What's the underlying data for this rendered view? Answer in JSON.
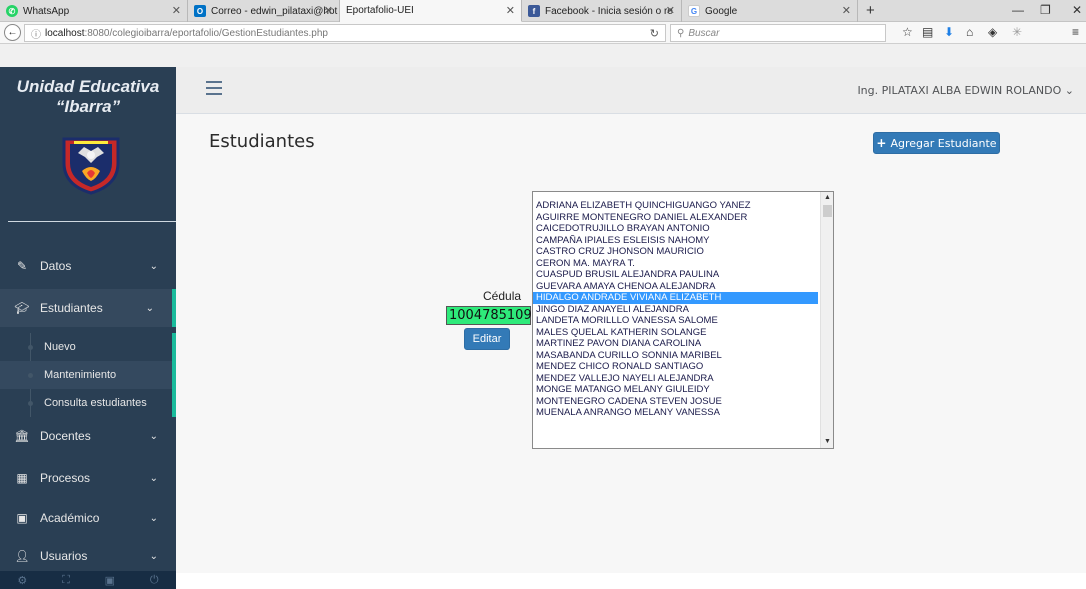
{
  "browser": {
    "tabs": [
      {
        "label": "WhatsApp",
        "icon": "whatsapp-icon"
      },
      {
        "label": "Correo - edwin_pilataxi@hot",
        "icon": "outlook-icon"
      },
      {
        "label": "Eportafolio-UEI",
        "icon": "none"
      },
      {
        "label": "Facebook - Inicia sesión o re",
        "icon": "facebook-icon"
      },
      {
        "label": "Google",
        "icon": "google-icon"
      }
    ],
    "url_host": "localhost",
    "url_path": ":8080/colegioibarra/eportafolio/GestionEstudiantes.php",
    "search_placeholder": "Buscar"
  },
  "sidebar": {
    "brand_line1": "Unidad Educativa",
    "brand_line2": "“Ibarra”",
    "menu": [
      {
        "label": "Datos",
        "icon": "edit-icon"
      },
      {
        "label": "Estudiantes",
        "icon": "graduation-cap-icon"
      },
      {
        "label": "Docentes",
        "icon": "institution-icon"
      },
      {
        "label": "Procesos",
        "icon": "table-icon"
      },
      {
        "label": "Académico",
        "icon": "newspaper-icon"
      },
      {
        "label": "Usuarios",
        "icon": "user-icon"
      }
    ],
    "submenu": [
      {
        "label": "Nuevo"
      },
      {
        "label": "Mantenimiento"
      },
      {
        "label": "Consulta estudiantes"
      }
    ]
  },
  "topnav": {
    "user_name": "Ing. PILATAXI ALBA EDWIN ROLANDO"
  },
  "main": {
    "title": "Estudiantes",
    "add_button": "Agregar Estudiante",
    "cedula_label": "Cédula",
    "cedula_value": "1004785109",
    "edit_button": "Editar",
    "students": [
      "ADRIANA ELIZABETH QUINCHIGUANGO YANEZ",
      "AGUIRRE MONTENEGRO DANIEL ALEXANDER",
      "CAICEDOTRUJILLO BRAYAN ANTONIO",
      "CAMPAÑA IPIALES ESLEISIS NAHOMY",
      "CASTRO CRUZ JHONSON MAURICIO",
      "CERON MA. MAYRA T.",
      "CUASPUD BRUSIL ALEJANDRA PAULINA",
      "GUEVARA AMAYA CHENOA ALEJANDRA",
      "HIDALGO ANDRADE VIVIANA ELIZABETH",
      "JINGO DIAZ ANAYELI ALEJANDRA",
      "LANDETA MORILLLO VANESSA SALOME",
      "MALES QUELAL KATHERIN SOLANGE",
      "MARTINEZ PAVON DIANA CAROLINA",
      "MASABANDA CURILLO SONNIA MARIBEL",
      "MENDEZ CHICO RONALD SANTIAGO",
      "MENDEZ VALLEJO NAYELI ALEJANDRA",
      "MONGE MATANGO MELANY GIULEIDY",
      "MONTENEGRO CADENA STEVEN JOSUE",
      "MUENALA ANRANGO MELANY VANESSA"
    ],
    "selected_student": "HIDALGO ANDRADE VIVIANA ELIZABETH"
  },
  "colors": {
    "sidebar": "#2a3f54",
    "accent": "#1abb9c",
    "primary_button": "#337ab7",
    "cedula_highlight": "#2eea7a",
    "selection": "#3399ff"
  }
}
